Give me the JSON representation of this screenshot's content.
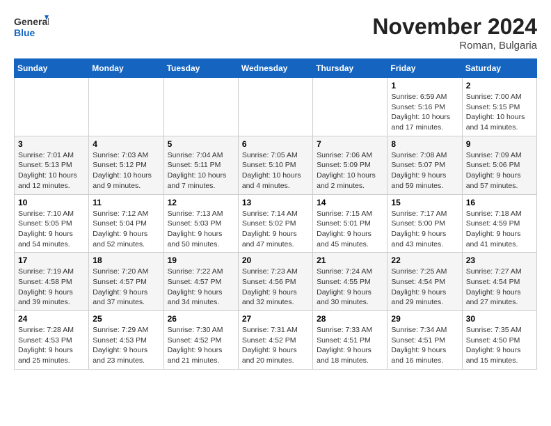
{
  "header": {
    "logo_line1": "General",
    "logo_line2": "Blue",
    "month_title": "November 2024",
    "location": "Roman, Bulgaria"
  },
  "weekdays": [
    "Sunday",
    "Monday",
    "Tuesday",
    "Wednesday",
    "Thursday",
    "Friday",
    "Saturday"
  ],
  "weeks": [
    [
      {
        "day": "",
        "info": ""
      },
      {
        "day": "",
        "info": ""
      },
      {
        "day": "",
        "info": ""
      },
      {
        "day": "",
        "info": ""
      },
      {
        "day": "",
        "info": ""
      },
      {
        "day": "1",
        "info": "Sunrise: 6:59 AM\nSunset: 5:16 PM\nDaylight: 10 hours and 17 minutes."
      },
      {
        "day": "2",
        "info": "Sunrise: 7:00 AM\nSunset: 5:15 PM\nDaylight: 10 hours and 14 minutes."
      }
    ],
    [
      {
        "day": "3",
        "info": "Sunrise: 7:01 AM\nSunset: 5:13 PM\nDaylight: 10 hours and 12 minutes."
      },
      {
        "day": "4",
        "info": "Sunrise: 7:03 AM\nSunset: 5:12 PM\nDaylight: 10 hours and 9 minutes."
      },
      {
        "day": "5",
        "info": "Sunrise: 7:04 AM\nSunset: 5:11 PM\nDaylight: 10 hours and 7 minutes."
      },
      {
        "day": "6",
        "info": "Sunrise: 7:05 AM\nSunset: 5:10 PM\nDaylight: 10 hours and 4 minutes."
      },
      {
        "day": "7",
        "info": "Sunrise: 7:06 AM\nSunset: 5:09 PM\nDaylight: 10 hours and 2 minutes."
      },
      {
        "day": "8",
        "info": "Sunrise: 7:08 AM\nSunset: 5:07 PM\nDaylight: 9 hours and 59 minutes."
      },
      {
        "day": "9",
        "info": "Sunrise: 7:09 AM\nSunset: 5:06 PM\nDaylight: 9 hours and 57 minutes."
      }
    ],
    [
      {
        "day": "10",
        "info": "Sunrise: 7:10 AM\nSunset: 5:05 PM\nDaylight: 9 hours and 54 minutes."
      },
      {
        "day": "11",
        "info": "Sunrise: 7:12 AM\nSunset: 5:04 PM\nDaylight: 9 hours and 52 minutes."
      },
      {
        "day": "12",
        "info": "Sunrise: 7:13 AM\nSunset: 5:03 PM\nDaylight: 9 hours and 50 minutes."
      },
      {
        "day": "13",
        "info": "Sunrise: 7:14 AM\nSunset: 5:02 PM\nDaylight: 9 hours and 47 minutes."
      },
      {
        "day": "14",
        "info": "Sunrise: 7:15 AM\nSunset: 5:01 PM\nDaylight: 9 hours and 45 minutes."
      },
      {
        "day": "15",
        "info": "Sunrise: 7:17 AM\nSunset: 5:00 PM\nDaylight: 9 hours and 43 minutes."
      },
      {
        "day": "16",
        "info": "Sunrise: 7:18 AM\nSunset: 4:59 PM\nDaylight: 9 hours and 41 minutes."
      }
    ],
    [
      {
        "day": "17",
        "info": "Sunrise: 7:19 AM\nSunset: 4:58 PM\nDaylight: 9 hours and 39 minutes."
      },
      {
        "day": "18",
        "info": "Sunrise: 7:20 AM\nSunset: 4:57 PM\nDaylight: 9 hours and 37 minutes."
      },
      {
        "day": "19",
        "info": "Sunrise: 7:22 AM\nSunset: 4:57 PM\nDaylight: 9 hours and 34 minutes."
      },
      {
        "day": "20",
        "info": "Sunrise: 7:23 AM\nSunset: 4:56 PM\nDaylight: 9 hours and 32 minutes."
      },
      {
        "day": "21",
        "info": "Sunrise: 7:24 AM\nSunset: 4:55 PM\nDaylight: 9 hours and 30 minutes."
      },
      {
        "day": "22",
        "info": "Sunrise: 7:25 AM\nSunset: 4:54 PM\nDaylight: 9 hours and 29 minutes."
      },
      {
        "day": "23",
        "info": "Sunrise: 7:27 AM\nSunset: 4:54 PM\nDaylight: 9 hours and 27 minutes."
      }
    ],
    [
      {
        "day": "24",
        "info": "Sunrise: 7:28 AM\nSunset: 4:53 PM\nDaylight: 9 hours and 25 minutes."
      },
      {
        "day": "25",
        "info": "Sunrise: 7:29 AM\nSunset: 4:53 PM\nDaylight: 9 hours and 23 minutes."
      },
      {
        "day": "26",
        "info": "Sunrise: 7:30 AM\nSunset: 4:52 PM\nDaylight: 9 hours and 21 minutes."
      },
      {
        "day": "27",
        "info": "Sunrise: 7:31 AM\nSunset: 4:52 PM\nDaylight: 9 hours and 20 minutes."
      },
      {
        "day": "28",
        "info": "Sunrise: 7:33 AM\nSunset: 4:51 PM\nDaylight: 9 hours and 18 minutes."
      },
      {
        "day": "29",
        "info": "Sunrise: 7:34 AM\nSunset: 4:51 PM\nDaylight: 9 hours and 16 minutes."
      },
      {
        "day": "30",
        "info": "Sunrise: 7:35 AM\nSunset: 4:50 PM\nDaylight: 9 hours and 15 minutes."
      }
    ]
  ]
}
